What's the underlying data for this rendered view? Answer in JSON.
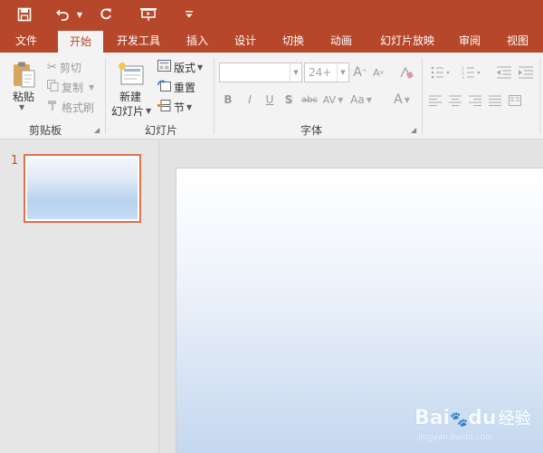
{
  "colors": {
    "accent": "#b7472a",
    "ribbon_bg": "#f3f3f3",
    "thumb_border": "#e0714a",
    "slide_gradient_end": "#c4d8f0"
  },
  "quick_access": {
    "save_icon": "save-icon",
    "undo_icon": "undo-icon",
    "redo_icon": "redo-icon",
    "present_icon": "present-from-beginning-icon",
    "customize_icon": "customize-toolbar-icon"
  },
  "tabs": [
    {
      "label": "文件",
      "active": false
    },
    {
      "label": "开始",
      "active": true
    },
    {
      "label": "开发工具",
      "active": false
    },
    {
      "label": "插入",
      "active": false
    },
    {
      "label": "设计",
      "active": false
    },
    {
      "label": "切换",
      "active": false
    },
    {
      "label": "动画",
      "active": false
    },
    {
      "label": "幻灯片放映",
      "active": false
    },
    {
      "label": "审阅",
      "active": false
    },
    {
      "label": "视图",
      "active": false
    }
  ],
  "ribbon": {
    "clipboard": {
      "group_label": "剪贴板",
      "paste_label": "粘贴",
      "cut_label": "剪切",
      "copy_label": "复制",
      "format_painter_label": "格式刷"
    },
    "slides": {
      "group_label": "幻灯片",
      "new_slide_line1": "新建",
      "new_slide_line2": "幻灯片",
      "layout_label": "版式",
      "reset_label": "重置",
      "section_label": "节"
    },
    "font": {
      "group_label": "字体",
      "font_name_value": "",
      "font_size_value": "24+",
      "bold_label": "B",
      "italic_label": "I",
      "underline_label": "U",
      "shadow_label": "S",
      "strike_label": "abc",
      "spacing_label": "AV",
      "case_label": "Aa",
      "color_label": "A"
    }
  },
  "slide_panel": {
    "slide_number": "1",
    "slide_count": 1
  },
  "watermark": {
    "brand": "Bai",
    "brand_suffix": "du",
    "product": "经验",
    "url": "jingyan.baidu.com"
  }
}
